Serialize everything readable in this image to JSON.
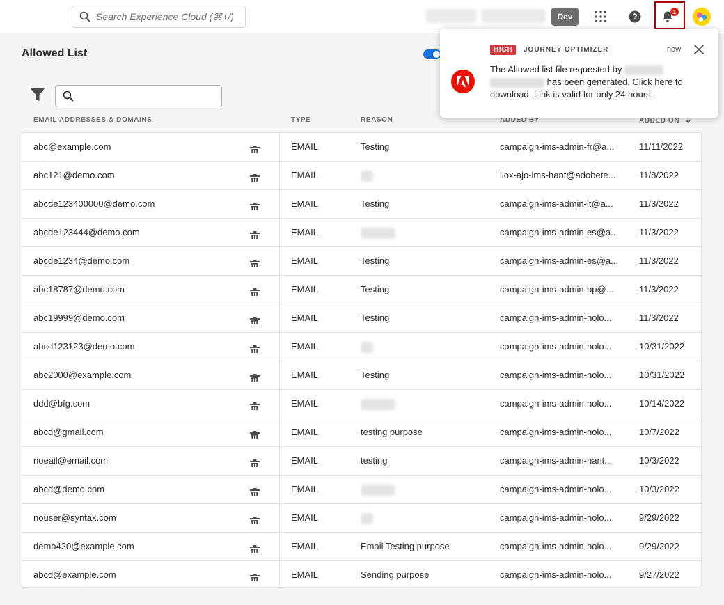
{
  "header": {
    "search_placeholder": "Search Experience Cloud (⌘+/)",
    "env_badge": "Dev",
    "notification_count": "1",
    "icons": [
      "search-icon",
      "apps-grid-icon",
      "help-icon",
      "bell-icon",
      "avatar"
    ]
  },
  "page": {
    "title": "Allowed List"
  },
  "table": {
    "columns": {
      "email": "EMAIL ADDRESSES & DOMAINS",
      "type": "TYPE",
      "reason": "REASON",
      "added_by": "ADDED BY",
      "added_on": "ADDED ON"
    },
    "rows": [
      {
        "email": "abc@example.com",
        "type": "EMAIL",
        "reason": "Testing",
        "added_by": "campaign-ims-admin-fr@a...",
        "added_on": "11/11/2022"
      },
      {
        "email": "abc121@demo.com",
        "type": "EMAIL",
        "reason": "",
        "added_by": "liox-ajo-ims-hant@adobete...",
        "added_on": "11/8/2022"
      },
      {
        "email": "abcde123400000@demo.com",
        "type": "EMAIL",
        "reason": "Testing",
        "added_by": "campaign-ims-admin-it@a...",
        "added_on": "11/3/2022"
      },
      {
        "email": "abcde123444@demo.com",
        "type": "EMAIL",
        "reason": "",
        "added_by": "campaign-ims-admin-es@a...",
        "added_on": "11/3/2022"
      },
      {
        "email": "abcde1234@demo.com",
        "type": "EMAIL",
        "reason": "Testing",
        "added_by": "campaign-ims-admin-es@a...",
        "added_on": "11/3/2022"
      },
      {
        "email": "abc18787@demo.com",
        "type": "EMAIL",
        "reason": "Testing",
        "added_by": "campaign-ims-admin-bp@...",
        "added_on": "11/3/2022"
      },
      {
        "email": "abc19999@demo.com",
        "type": "EMAIL",
        "reason": "Testing",
        "added_by": "campaign-ims-admin-nolo...",
        "added_on": "11/3/2022"
      },
      {
        "email": "abcd123123@demo.com",
        "type": "EMAIL",
        "reason": "",
        "added_by": "campaign-ims-admin-nolo...",
        "added_on": "10/31/2022"
      },
      {
        "email": "abc2000@example.com",
        "type": "EMAIL",
        "reason": "Testing",
        "added_by": "campaign-ims-admin-nolo...",
        "added_on": "10/31/2022"
      },
      {
        "email": "ddd@bfg.com",
        "type": "EMAIL",
        "reason": "",
        "added_by": "campaign-ims-admin-nolo...",
        "added_on": "10/14/2022"
      },
      {
        "email": "abcd@gmail.com",
        "type": "EMAIL",
        "reason": "testing purpose",
        "added_by": "campaign-ims-admin-nolo...",
        "added_on": "10/7/2022"
      },
      {
        "email": "noeail@email.com",
        "type": "EMAIL",
        "reason": "testing",
        "added_by": "campaign-ims-admin-hant...",
        "added_on": "10/3/2022"
      },
      {
        "email": "abcd@demo.com",
        "type": "EMAIL",
        "reason": "",
        "added_by": "campaign-ims-admin-nolo...",
        "added_on": "10/3/2022"
      },
      {
        "email": "nouser@syntax.com",
        "type": "EMAIL",
        "reason": "",
        "added_by": "campaign-ims-admin-nolo...",
        "added_on": "9/29/2022"
      },
      {
        "email": "demo420@example.com",
        "type": "EMAIL",
        "reason": "Email Testing purpose",
        "added_by": "campaign-ims-admin-nolo...",
        "added_on": "9/29/2022"
      },
      {
        "email": "abcd@example.com",
        "type": "EMAIL",
        "reason": "Sending purpose",
        "added_by": "campaign-ims-admin-nolo...",
        "added_on": "9/27/2022"
      }
    ]
  },
  "notification": {
    "priority": "HIGH",
    "source": "JOURNEY OPTIMIZER",
    "time": "now",
    "message_part1": "The Allowed list file requested by",
    "message_part2": "has been generated. Click here to download. Link is valid for only 24 hours."
  },
  "colors": {
    "accent": "#1473e6",
    "adobe_red": "#eb1000",
    "high_badge": "#d7373f",
    "bell_highlight": "#b40000"
  }
}
